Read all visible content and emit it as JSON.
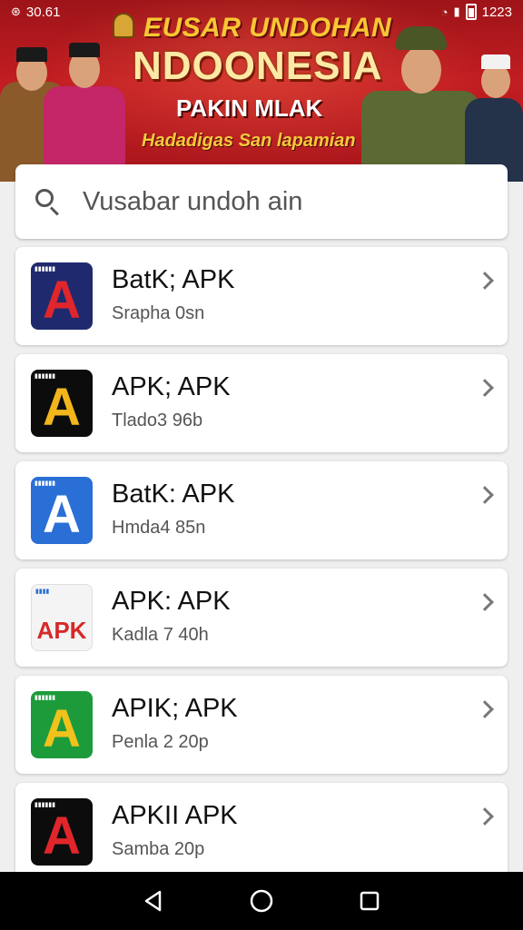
{
  "status_bar": {
    "left_time": "30.61",
    "right_time": "1223"
  },
  "banner": {
    "line1": "EUSAR UNDOHAN",
    "line2": "NDOONESIA",
    "line3": "PAKIN MLAK",
    "line4": "Hadadigas San lapamian"
  },
  "search": {
    "placeholder": "Vusabar undoh ain"
  },
  "apps": [
    {
      "title": "BatK; APK",
      "subtitle": "Srapha 0sn",
      "icon": "letter-a-red-on-navy",
      "icon_bg": "#1f2a6e",
      "glyph_color": "#e0262b"
    },
    {
      "title": "APK; APK",
      "subtitle": "Tlado3 96b",
      "icon": "letter-a-multicolor-on-black",
      "icon_bg": "#0c0c0c",
      "glyph_color": "#f2b61c"
    },
    {
      "title": "BatK: APK",
      "subtitle": "Hmda4 85n",
      "icon": "letter-a-blue",
      "icon_bg": "#2a6fd6",
      "glyph_color": "#ffffff"
    },
    {
      "title": "APK: APK",
      "subtitle": "Kadla 7 40h",
      "icon": "apk-document-icon",
      "icon_bg": "#f4f4f4",
      "glyph_color": "#d62a2a"
    },
    {
      "title": "APIK; APK",
      "subtitle": "Penla 2 20p",
      "icon": "letter-a-on-green",
      "icon_bg": "#1d9b3b",
      "glyph_color": "#f2c21c"
    },
    {
      "title": "APKII APK",
      "subtitle": "Samba 20p",
      "icon": "letter-a-red-on-black",
      "icon_bg": "#0c0c0c",
      "glyph_color": "#e0262b"
    }
  ]
}
